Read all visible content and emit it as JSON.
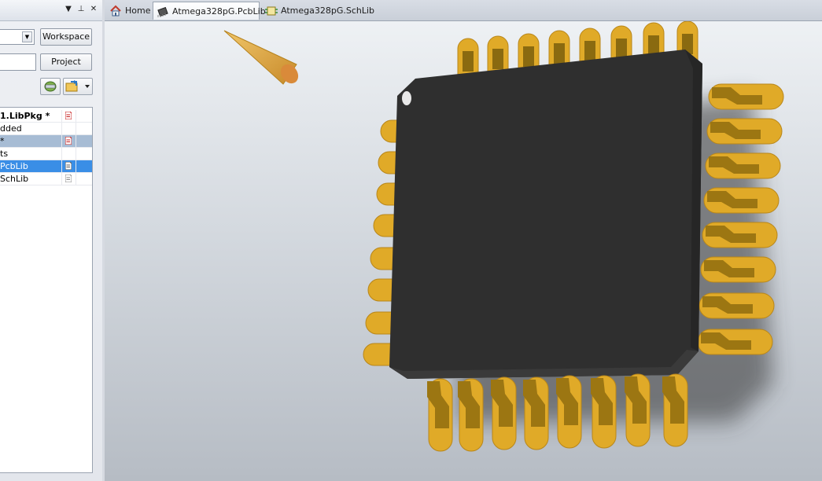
{
  "panel": {
    "header_buttons": [
      "▼",
      "⊥",
      "✕"
    ],
    "workspace_button": "Workspace",
    "project_button": "Project",
    "tree_rows": [
      {
        "label": "1.LibPkg *",
        "state": "bold"
      },
      {
        "label": "dded",
        "state": "normal"
      },
      {
        "label": " *",
        "state": "grey"
      },
      {
        "label": "ts",
        "state": "normal"
      },
      {
        "label": "PcbLib",
        "state": "blue"
      },
      {
        "label": "SchLib",
        "state": "normal"
      }
    ]
  },
  "tabs": [
    {
      "label": "Home",
      "icon": "home-icon",
      "active": false
    },
    {
      "label": "Atmega328pG.PcbLib",
      "icon": "pcb-chip-icon",
      "active": true
    },
    {
      "label": "Atmega328pG.SchLib",
      "icon": "schematic-icon",
      "active": false
    }
  ],
  "colors": {
    "pins": "#e0aa28",
    "pin_dark": "#8a6a10",
    "body": "#2f2f2f",
    "accent_tab": "#9ba4b1"
  },
  "viewport": {
    "model": "TQFP-32 chip body with 32 gull-wing pins",
    "top_pins": 8,
    "right_pins": 8,
    "bottom_pins": 8,
    "left_pins": 8
  }
}
